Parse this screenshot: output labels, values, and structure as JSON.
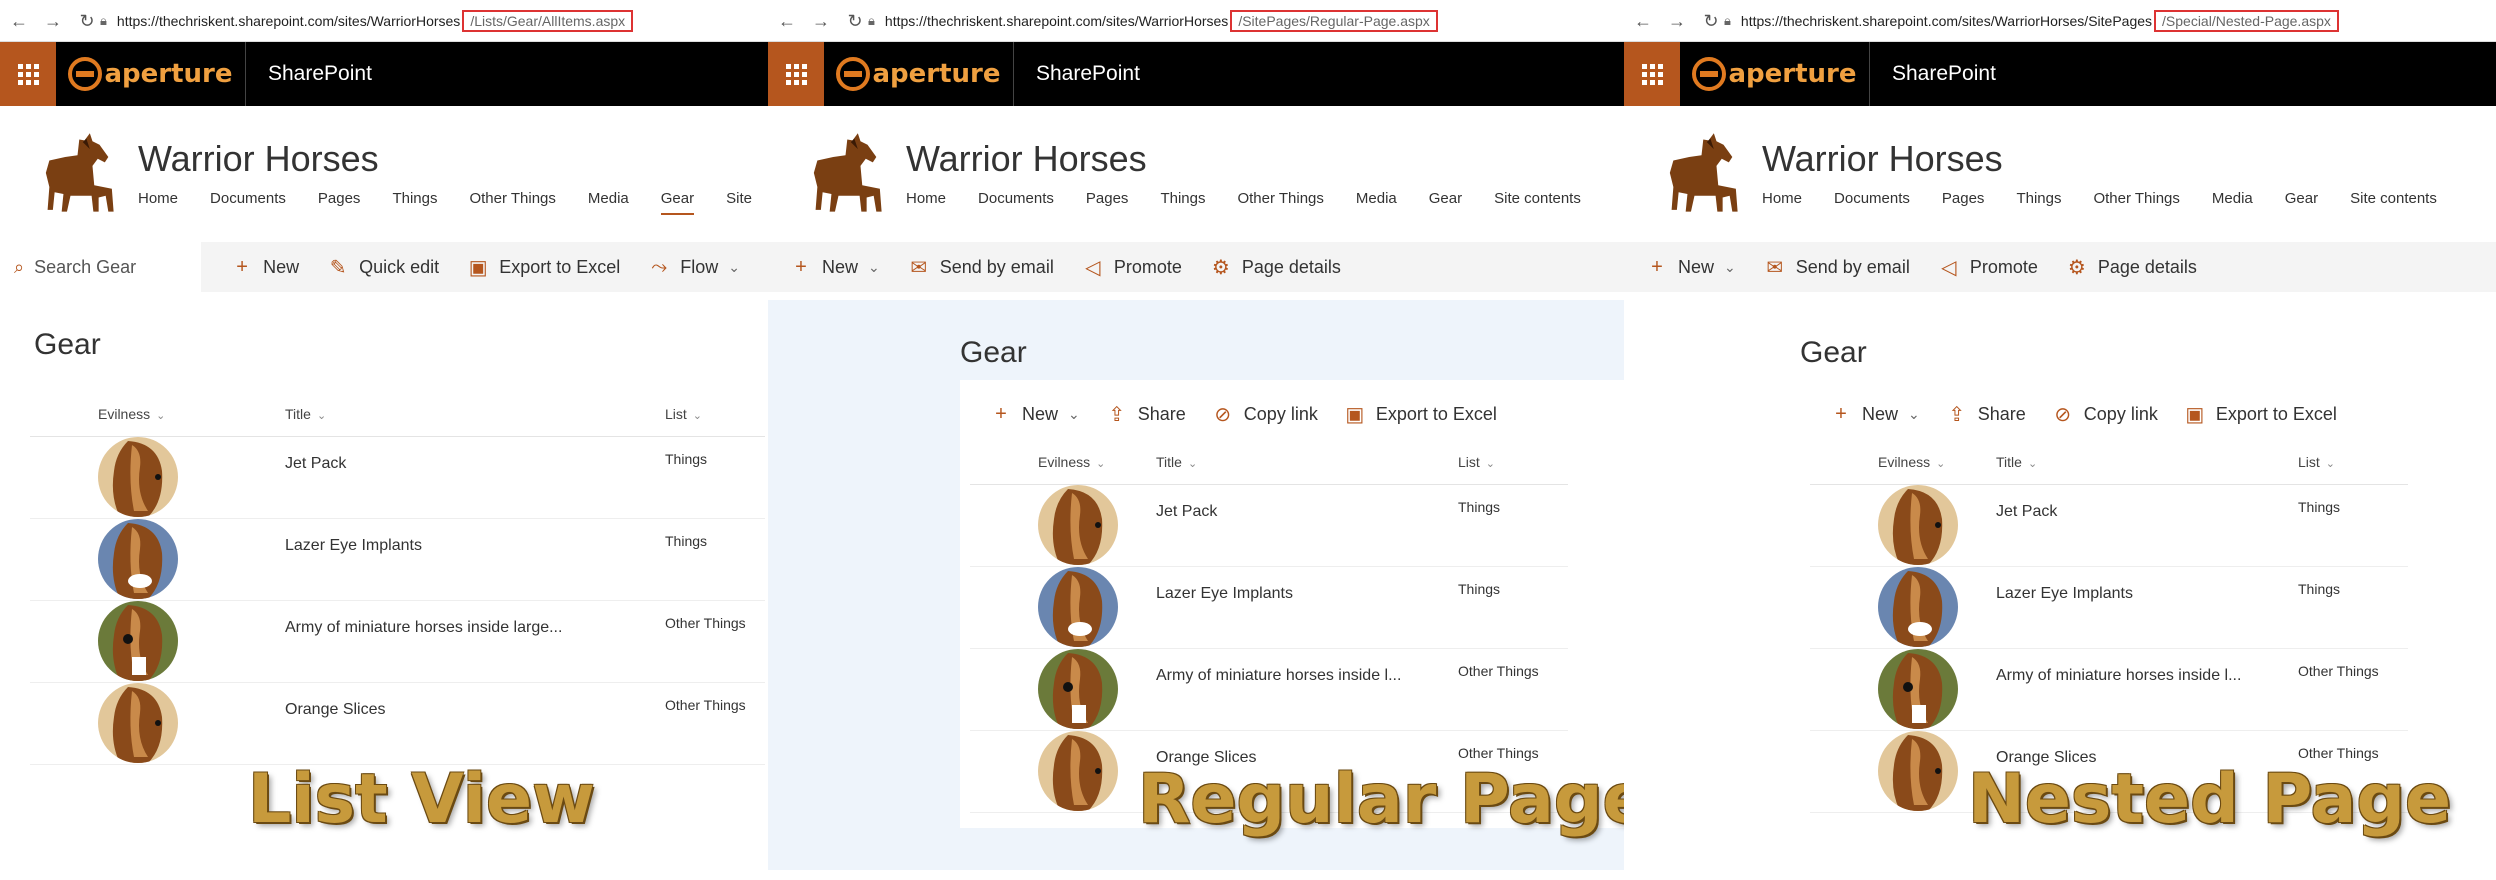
{
  "brand": {
    "suite_title": "SharePoint",
    "logo_text": "aperture",
    "site_title": "Warrior Horses",
    "accent": "#b5561e"
  },
  "panels": [
    {
      "url_base": "https://thechriskent.sharepoint.com/sites/WarriorHorses",
      "url_path": "/Lists/Gear/AllItems.aspx",
      "nav": [
        "Home",
        "Documents",
        "Pages",
        "Things",
        "Other Things",
        "Media",
        "Gear",
        "Site"
      ],
      "search_placeholder": "Search Gear",
      "commands": [
        "New",
        "Quick edit",
        "Export to Excel",
        "Flow"
      ],
      "section_title": "Gear",
      "overlay": "List View"
    },
    {
      "url_base": "https://thechriskent.sharepoint.com/sites/WarriorHorses",
      "url_path": "/SitePages/Regular-Page.aspx",
      "nav": [
        "Home",
        "Documents",
        "Pages",
        "Things",
        "Other Things",
        "Media",
        "Gear",
        "Site contents"
      ],
      "commands": [
        "New",
        "Send by email",
        "Promote",
        "Page details"
      ],
      "section_title": "Gear",
      "web_commands": [
        "New",
        "Share",
        "Copy link",
        "Export to Excel"
      ],
      "overlay": "Regular Page"
    },
    {
      "url_base": "https://thechriskent.sharepoint.com/sites/WarriorHorses/SitePages",
      "url_path": "/Special/Nested-Page.aspx",
      "nav": [
        "Home",
        "Documents",
        "Pages",
        "Things",
        "Other Things",
        "Media",
        "Gear",
        "Site contents"
      ],
      "commands": [
        "New",
        "Send by email",
        "Promote",
        "Page details"
      ],
      "section_title": "Gear",
      "web_commands": [
        "New",
        "Share",
        "Copy link",
        "Export to Excel"
      ],
      "overlay": "Nested Page"
    }
  ],
  "table": {
    "headers": [
      "Evilness",
      "Title",
      "List"
    ],
    "rows": [
      {
        "title": "Jet Pack",
        "title_short": "Jet Pack",
        "list": "Things",
        "avatar": "calm-horse"
      },
      {
        "title": "Lazer Eye Implants",
        "title_short": "Lazer Eye Implants",
        "list": "Things",
        "avatar": "angry-horse"
      },
      {
        "title": "Army of miniature horses inside large...",
        "title_short": "Army of miniature horses inside l...",
        "list": "Other Things",
        "avatar": "teeth-horse"
      },
      {
        "title": "Orange Slices",
        "title_short": "Orange Slices",
        "list": "Other Things",
        "avatar": "calm-horse"
      }
    ]
  }
}
